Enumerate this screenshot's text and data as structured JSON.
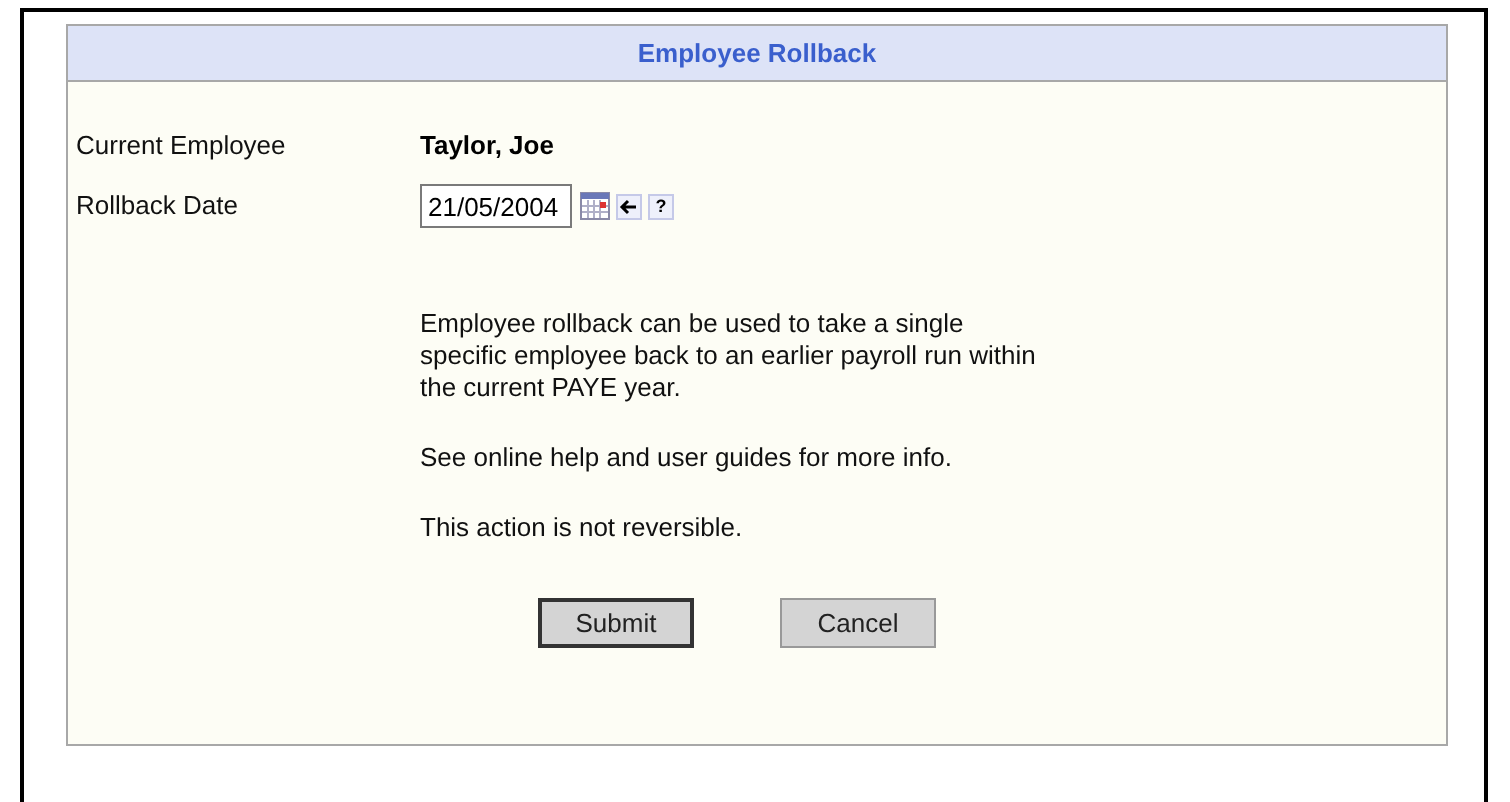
{
  "panel": {
    "title": "Employee Rollback"
  },
  "fields": [
    {
      "label": "Current Employee",
      "kind": "text",
      "value": "Taylor, Joe"
    },
    {
      "label": "Rollback Date",
      "kind": "date",
      "value": "21/05/2004",
      "help": "?"
    }
  ],
  "paragraphs": [
    "Employee rollback can be used to take a single specific employee back to an earlier payroll run within the current PAYE year.",
    "See online help and user guides for more info.",
    "This action is not reversible."
  ],
  "buttons": [
    {
      "label": "Submit",
      "default": true
    },
    {
      "label": "Cancel",
      "default": false
    }
  ]
}
